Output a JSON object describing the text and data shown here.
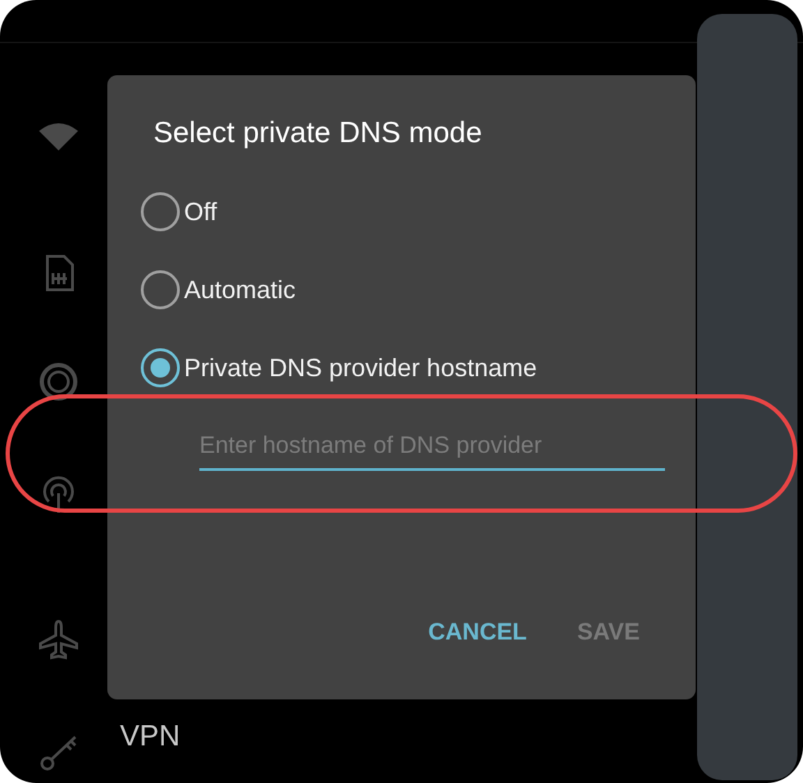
{
  "background_list": {
    "vpn_title": "VPN"
  },
  "dialog": {
    "title": "Select private DNS mode",
    "options": [
      {
        "label": "Off",
        "selected": false
      },
      {
        "label": "Automatic",
        "selected": false
      },
      {
        "label": "Private DNS provider hostname",
        "selected": true
      }
    ],
    "hostname_field": {
      "placeholder": "Enter hostname of DNS provider"
    },
    "buttons": [
      {
        "label": "CANCEL",
        "disabled": false
      },
      {
        "label": "SAVE",
        "disabled": true
      }
    ]
  },
  "annotation": {
    "kind": "highlight"
  }
}
